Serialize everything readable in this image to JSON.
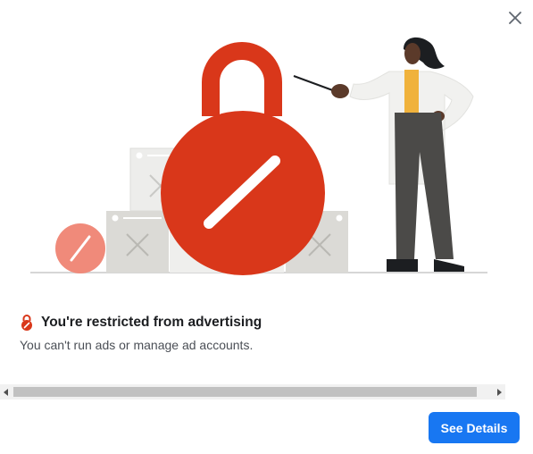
{
  "dialog": {
    "close_label": "Close",
    "icons": {
      "close": "close-icon",
      "lock": "lock-icon"
    },
    "illustration": {
      "alt": "Restricted advertising illustration"
    },
    "title": "You're restricted from advertising",
    "description": "You can't run ads or manage ad accounts.",
    "primary_button": "See Details"
  },
  "colors": {
    "accent": "#1877f2",
    "restriction_red": "#d9371a",
    "title_text": "#1c1e21",
    "body_text": "#4b4f56"
  }
}
